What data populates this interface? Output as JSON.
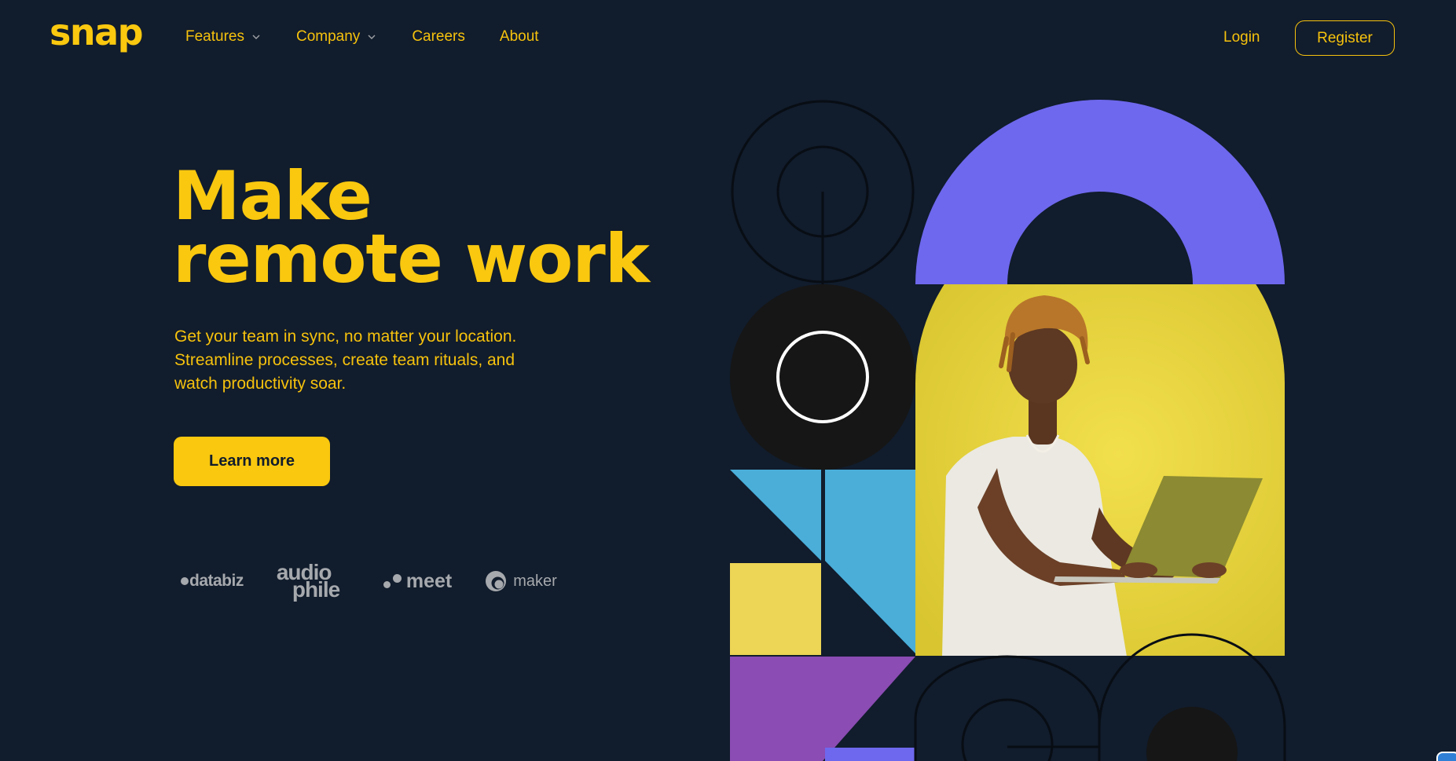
{
  "brand": {
    "logo_text": "snap"
  },
  "nav": {
    "items": [
      {
        "label": "Features",
        "has_dropdown": true
      },
      {
        "label": "Company",
        "has_dropdown": true
      },
      {
        "label": "Careers",
        "has_dropdown": false
      },
      {
        "label": "About",
        "has_dropdown": false
      }
    ],
    "login_label": "Login",
    "register_label": "Register"
  },
  "hero": {
    "title_lines": [
      "Make",
      "remote work"
    ],
    "description_lines": [
      "Get your team in sync, no matter your location.",
      "Streamline processes, create team rituals, and",
      "watch productivity soar."
    ],
    "cta_label": "Learn more"
  },
  "clients": {
    "databiz": "databiz",
    "audiophile_lines": [
      "audio",
      "phile"
    ],
    "meet": "meet",
    "maker": "maker"
  },
  "colors": {
    "background": "#111c2c",
    "accent_yellow": "#f9c80f",
    "purple_arch": "#6e68ee",
    "black_disc": "#161616",
    "sky_blue": "#4aaed9",
    "light_yellow": "#edd555",
    "violet": "#8b4cb3",
    "client_grey": "#a6a9ad"
  },
  "icons": {
    "dropdown": "chevron-down-icon",
    "maker_logo": "maker-logo-icon"
  }
}
